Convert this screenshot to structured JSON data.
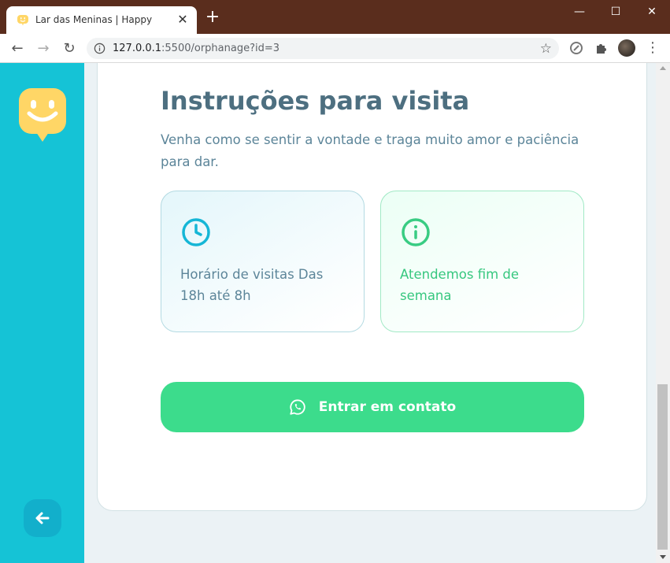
{
  "browser": {
    "tab_title": "Lar das Meninas | Happy",
    "tab_close": "✕",
    "new_tab": "+",
    "window_controls": {
      "minimize": "—",
      "maximize": "☐",
      "close": "✕"
    },
    "url_host": "127.0.0.1",
    "url_path": ":5500/orphanage?id=3",
    "nav": {
      "back": "←",
      "forward": "→",
      "reload": "↻",
      "star": "☆",
      "menu": "⋮"
    },
    "icons": [
      "info-icon",
      "star-icon",
      "extension-icon",
      "puzzle-icon",
      "avatar",
      "menu-dots-icon"
    ]
  },
  "sidebar": {
    "logo": "happy-logo-icon",
    "back_button": "arrow-left-icon",
    "color": "#15c3d6"
  },
  "main": {
    "heading": "Instruções para visita",
    "description": "Venha como se sentir a vontade e traga muito amor e paciência para dar.",
    "info_cards": [
      {
        "icon": "clock-icon",
        "text": "Horário de visitas Das 18h até 8h",
        "color": "#15b6d6"
      },
      {
        "icon": "info-circle-icon",
        "text": "Atendemos fim de semana",
        "color": "#39cc83"
      }
    ],
    "contact_button": {
      "icon": "whatsapp-icon",
      "label": "Entrar em contato",
      "color": "#3cdc8c"
    }
  },
  "colors": {
    "title_bar": "#5a2d1d",
    "heading": "#4d6f80",
    "text": "#5c8599",
    "background": "#ebf2f5"
  }
}
